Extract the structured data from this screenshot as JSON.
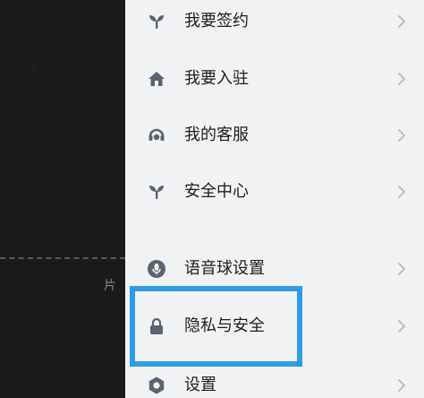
{
  "background": {
    "truncated_text": "片"
  },
  "drawer": {
    "items": [
      {
        "label": "我要签约",
        "icon": "sprout-icon"
      },
      {
        "label": "我要入驻",
        "icon": "house-icon"
      },
      {
        "label": "我的客服",
        "icon": "headset-icon"
      },
      {
        "label": "安全中心",
        "icon": "sprout-icon"
      },
      {
        "label": "语音球设置",
        "icon": "microphone-icon"
      },
      {
        "label": "隐私与安全",
        "icon": "lock-icon"
      },
      {
        "label": "设置",
        "icon": "gear-icon"
      }
    ],
    "highlighted_item": "隐私与安全"
  },
  "colors": {
    "drawer_background": "#f1f2f4",
    "icon": "#5b6270",
    "chevron": "#b5b8bf",
    "highlight": "#2d9be6",
    "teal_block": "#1f6f86"
  }
}
